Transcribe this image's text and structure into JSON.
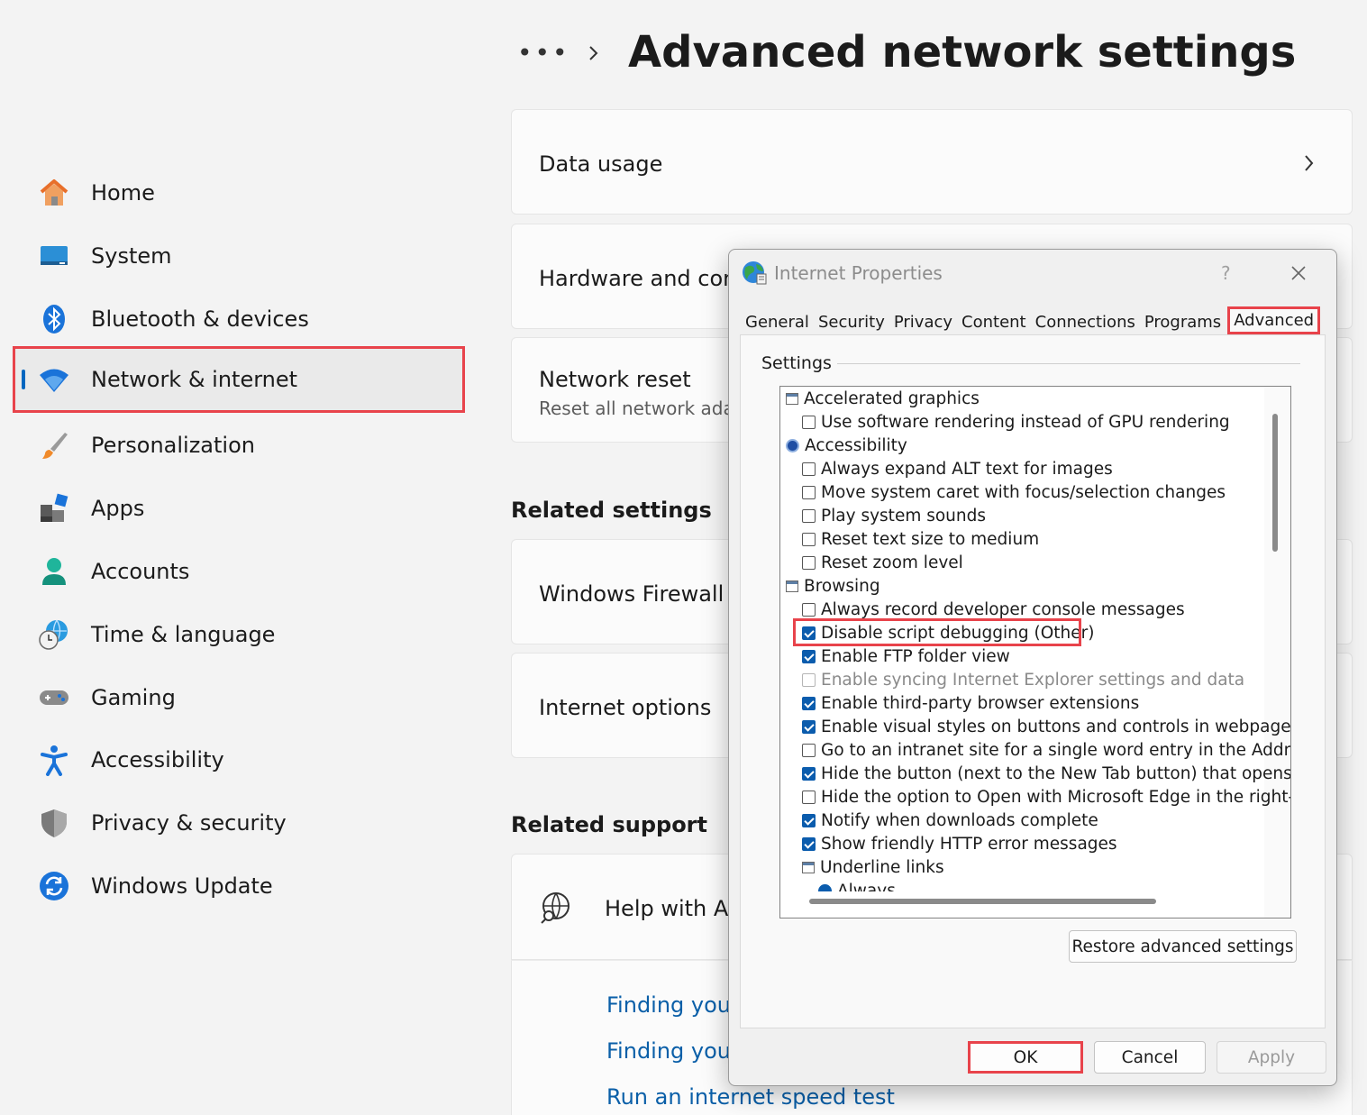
{
  "header": {
    "title": "Advanced network settings",
    "more_label": "•••"
  },
  "sidebar": {
    "items": [
      {
        "label": "Home",
        "icon": "home-icon"
      },
      {
        "label": "System",
        "icon": "system-icon"
      },
      {
        "label": "Bluetooth & devices",
        "icon": "bluetooth-icon"
      },
      {
        "label": "Network & internet",
        "icon": "wifi-icon",
        "selected": true
      },
      {
        "label": "Personalization",
        "icon": "brush-icon"
      },
      {
        "label": "Apps",
        "icon": "apps-icon"
      },
      {
        "label": "Accounts",
        "icon": "account-icon"
      },
      {
        "label": "Time & language",
        "icon": "globe-clock-icon"
      },
      {
        "label": "Gaming",
        "icon": "gamepad-icon"
      },
      {
        "label": "Accessibility",
        "icon": "accessibility-icon"
      },
      {
        "label": "Privacy & security",
        "icon": "shield-icon"
      },
      {
        "label": "Windows Update",
        "icon": "update-icon"
      }
    ]
  },
  "main": {
    "data_usage": "Data usage",
    "hardware": "Hardware and conn",
    "network_reset": {
      "title": "Network reset",
      "subtitle": "Reset all network adap"
    },
    "related_settings": "Related settings",
    "firewall": "Windows Firewall",
    "internet_options": "Internet options",
    "related_support": "Related support",
    "help": "Help with Ad",
    "links": [
      "Finding your",
      "Finding your",
      "Run an internet speed test"
    ]
  },
  "dialog": {
    "title": "Internet Properties",
    "help": "?",
    "tabs": [
      "General",
      "Security",
      "Privacy",
      "Content",
      "Connections",
      "Programs",
      "Advanced"
    ],
    "active_tab": "Advanced",
    "group_label": "Settings",
    "rows": [
      {
        "type": "group",
        "label": "Accelerated graphics"
      },
      {
        "type": "check",
        "checked": false,
        "label": "Use software rendering instead of GPU rendering"
      },
      {
        "type": "accgroup",
        "label": "Accessibility"
      },
      {
        "type": "check",
        "checked": false,
        "label": "Always expand ALT text for images"
      },
      {
        "type": "check",
        "checked": false,
        "label": "Move system caret with focus/selection changes"
      },
      {
        "type": "check",
        "checked": false,
        "label": "Play system sounds"
      },
      {
        "type": "check",
        "checked": false,
        "label": "Reset text size to medium"
      },
      {
        "type": "check",
        "checked": false,
        "label": "Reset zoom level"
      },
      {
        "type": "group",
        "label": "Browsing"
      },
      {
        "type": "check",
        "checked": false,
        "label": "Always record developer console messages"
      },
      {
        "type": "check",
        "checked": true,
        "label": "Disable script debugging (Other)"
      },
      {
        "type": "check",
        "checked": true,
        "label": "Enable FTP folder view"
      },
      {
        "type": "check",
        "checked": false,
        "disabled": true,
        "label": "Enable syncing Internet Explorer settings and data"
      },
      {
        "type": "check",
        "checked": true,
        "label": "Enable third-party browser extensions"
      },
      {
        "type": "check",
        "checked": true,
        "label": "Enable visual styles on buttons and controls in webpages"
      },
      {
        "type": "check",
        "checked": false,
        "label": "Go to an intranet site for a single word entry in the Addres"
      },
      {
        "type": "check",
        "checked": true,
        "label": "Hide the button (next to the New Tab button) that opens M"
      },
      {
        "type": "check",
        "checked": false,
        "label": "Hide the option to Open with Microsoft Edge in the right-cl"
      },
      {
        "type": "check",
        "checked": true,
        "label": "Notify when downloads complete"
      },
      {
        "type": "check",
        "checked": true,
        "label": "Show friendly HTTP error messages"
      },
      {
        "type": "subgroup",
        "label": "Underline links"
      },
      {
        "type": "radio",
        "label": "Always"
      }
    ],
    "restore_label": "Restore advanced settings",
    "ok_label": "OK",
    "cancel_label": "Cancel",
    "apply_label": "Apply"
  }
}
